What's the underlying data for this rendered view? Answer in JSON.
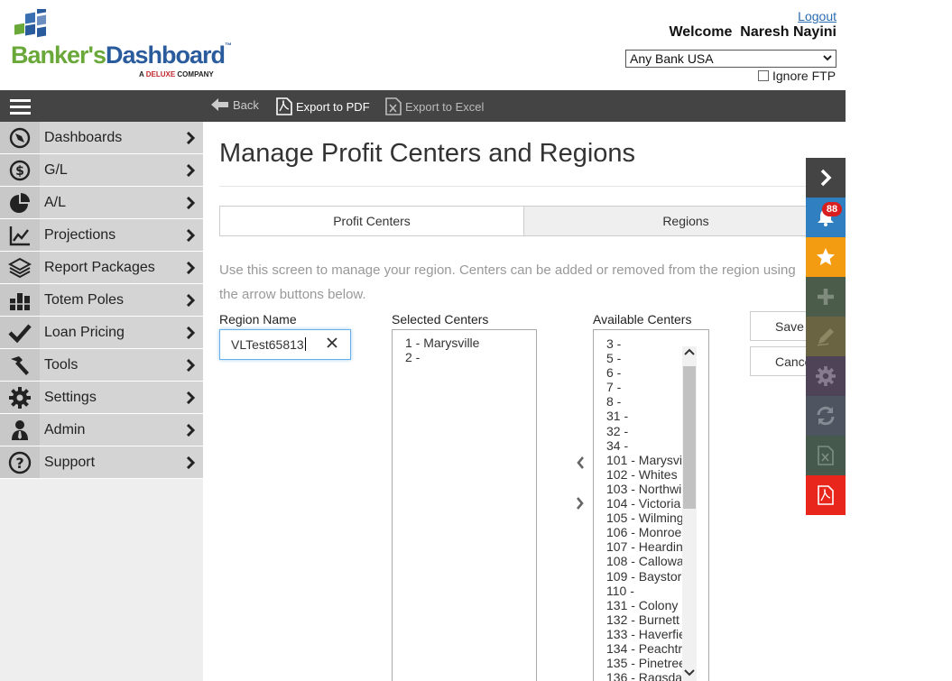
{
  "header": {
    "logo_bankers": "Banker's",
    "logo_dashboard": "Dashboard",
    "logo_tm": "™",
    "logo_sub_prefix": "A",
    "logo_sub_brand": "DELUXE",
    "logo_sub_suffix": "COMPANY",
    "logout": "Logout",
    "welcome": "Welcome  Naresh Nayini",
    "bank_selected": "Any Bank USA",
    "ignore_ftp": "Ignore FTP"
  },
  "toolbar": {
    "back": "Back",
    "export_pdf": "Export to PDF",
    "export_excel": "Export to Excel"
  },
  "sidebar": {
    "items": [
      {
        "label": "Dashboards",
        "icon": "compass-icon"
      },
      {
        "label": "G/L",
        "icon": "dollar-icon"
      },
      {
        "label": "A/L",
        "icon": "pie-chart-icon"
      },
      {
        "label": "Projections",
        "icon": "line-chart-icon"
      },
      {
        "label": "Report Packages",
        "icon": "layers-icon"
      },
      {
        "label": "Totem Poles",
        "icon": "bar-chart-icon"
      },
      {
        "label": "Loan Pricing",
        "icon": "check-icon"
      },
      {
        "label": "Tools",
        "icon": "hammer-icon"
      },
      {
        "label": "Settings",
        "icon": "gear-icon"
      },
      {
        "label": "Admin",
        "icon": "user-tie-icon"
      },
      {
        "label": "Support",
        "icon": "question-icon"
      }
    ]
  },
  "main": {
    "title": "Manage Profit Centers and Regions",
    "tabs": [
      {
        "label": "Profit Centers"
      },
      {
        "label": "Regions"
      }
    ],
    "description_line1": "Use this screen to manage your region. Centers can be added or removed from the region using",
    "description_line2": "the arrow buttons below.",
    "region_name_label": "Region Name",
    "region_name_value": "VLTest65813",
    "selected_centers_label": "Selected Centers",
    "available_centers_label": "Available Centers",
    "selected_centers": [
      "1 - Marysville",
      "2 -"
    ],
    "available_centers": [
      "3 -",
      "5 -",
      "6 -",
      "7 -",
      "8 -",
      "31 -",
      "32 -",
      "34 -",
      "101 - Marysvi",
      "102 - Whites",
      "103 - Northwi",
      "104 - Victoria",
      "105 - Wilming",
      "106 - Monroe",
      "107 - Heardin",
      "108 - Callowa",
      "109 - Baystor",
      "110 -",
      "131 - Colony",
      "132 - Burnett",
      "133 - Haverfie",
      "134 - Peachtr",
      "135 - Pinetree",
      "136 - Ragsda"
    ],
    "save": "Save",
    "cancel": "Cancel"
  },
  "right_panel": {
    "notification_count": "88",
    "buttons": [
      {
        "name": "collapse-panel-button",
        "icon": "chevron-right-icon",
        "color": "#444444"
      },
      {
        "name": "notifications-button",
        "icon": "bell-icon",
        "color": "#2f7fc1"
      },
      {
        "name": "favorites-button",
        "icon": "star-icon",
        "color": "#f39c12"
      },
      {
        "name": "add-button",
        "icon": "plus-icon",
        "color": "#4c5c4a"
      },
      {
        "name": "edit-button",
        "icon": "pencil-icon",
        "color": "#6a6443"
      },
      {
        "name": "settings-button",
        "icon": "gear-icon",
        "color": "#4f4457"
      },
      {
        "name": "refresh-button",
        "icon": "refresh-icon",
        "color": "#4e5560"
      },
      {
        "name": "export-excel-button",
        "icon": "excel-icon",
        "color": "#455a4c"
      },
      {
        "name": "export-pdf-button",
        "icon": "pdf-icon",
        "color": "#e8261c"
      }
    ]
  }
}
